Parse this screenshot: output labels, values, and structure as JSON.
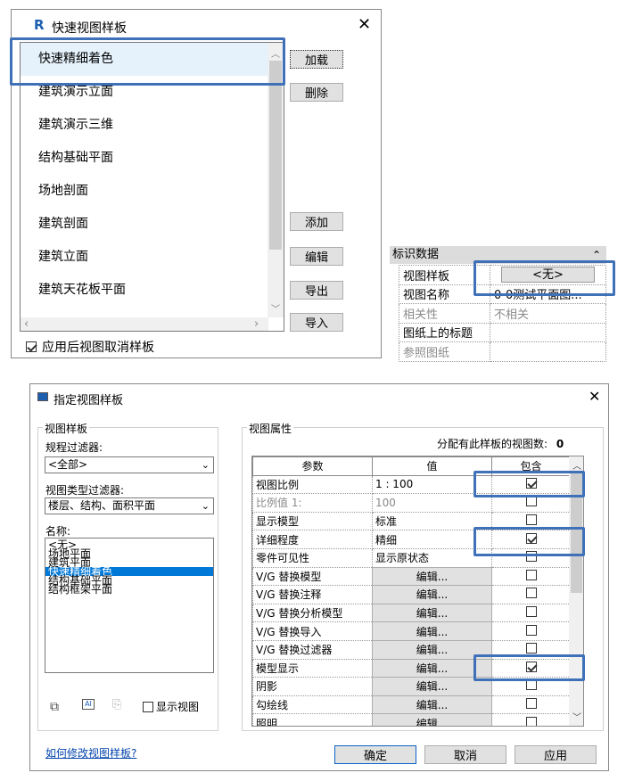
{
  "quick_dialog": {
    "title": "快速视图样板",
    "app_icon": "R",
    "items": [
      "快速精细着色",
      "建筑演示立面",
      "建筑演示三维",
      "结构基础平面",
      "场地剖面",
      "建筑剖面",
      "建筑立面",
      "建筑天花板平面"
    ],
    "buttons": {
      "load": "加载",
      "delete": "删除",
      "add": "添加",
      "edit": "编辑",
      "export": "导出",
      "import": "导入"
    },
    "checkbox_label": "应用后视图取消样板"
  },
  "identity_panel": {
    "header": "标识数据",
    "rows": [
      {
        "k": "视图样板",
        "v": "<无>"
      },
      {
        "k": "视图名称",
        "v": "0-0测试平面图..."
      },
      {
        "k": "相关性",
        "v": "不相关"
      },
      {
        "k": "图纸上的标题",
        "v": ""
      },
      {
        "k": "参照图纸",
        "v": ""
      }
    ]
  },
  "assign_dialog": {
    "title": "指定视图样板",
    "left_group": "视图样板",
    "discipline_label": "规程过滤器:",
    "discipline_value": "<全部>",
    "viewtype_label": "视图类型过滤器:",
    "viewtype_value": "楼层、结构、面积平面",
    "name_label": "名称:",
    "names": [
      "<无>",
      "场地平面",
      "建筑平面",
      "快速精细着色",
      "结构基础平面",
      "结构框架平面"
    ],
    "show_views_label": "显示视图",
    "right_group": "视图属性",
    "count_label": "分配有此样板的视图数:",
    "count_value": "0",
    "col_param": "参数",
    "col_value": "值",
    "col_include": "包含",
    "rows": [
      {
        "p": "视图比例",
        "v": "1 : 100",
        "inc": true
      },
      {
        "p": "比例值 1:",
        "v": "100",
        "inc": false
      },
      {
        "p": "显示模型",
        "v": "标准",
        "inc": false
      },
      {
        "p": "详细程度",
        "v": "精细",
        "inc": true
      },
      {
        "p": "零件可见性",
        "v": "显示原状态",
        "inc": false
      },
      {
        "p": "V/G 替换模型",
        "v": "编辑...",
        "inc": false
      },
      {
        "p": "V/G 替换注释",
        "v": "编辑...",
        "inc": false
      },
      {
        "p": "V/G 替换分析模型",
        "v": "编辑...",
        "inc": false
      },
      {
        "p": "V/G 替换导入",
        "v": "编辑...",
        "inc": false
      },
      {
        "p": "V/G 替换过滤器",
        "v": "编辑...",
        "inc": false
      },
      {
        "p": "模型显示",
        "v": "编辑...",
        "inc": true
      },
      {
        "p": "阴影",
        "v": "编辑...",
        "inc": false
      },
      {
        "p": "勾绘线",
        "v": "编辑...",
        "inc": false
      },
      {
        "p": "照明",
        "v": "编辑...",
        "inc": false
      }
    ],
    "help_link": "如何修改视图样板?",
    "ok": "确定",
    "cancel": "取消",
    "apply": "应用"
  }
}
